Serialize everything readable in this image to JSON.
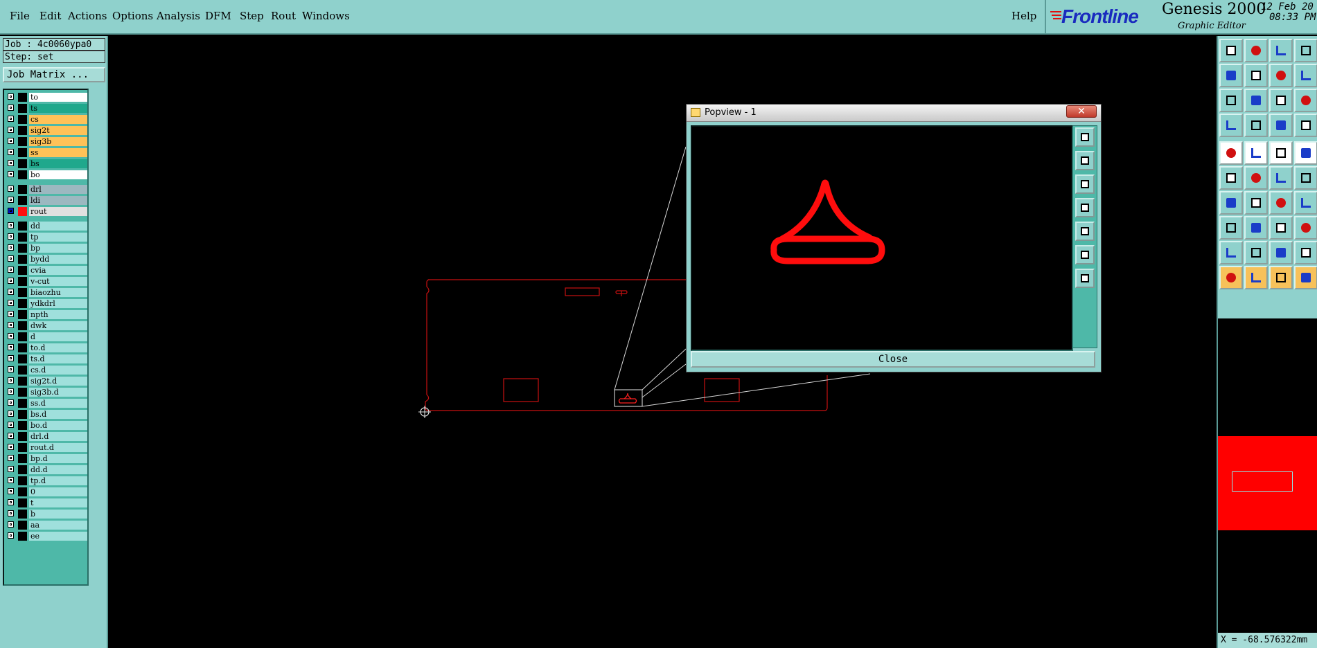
{
  "menu": {
    "items": [
      "File",
      "Edit",
      "Actions",
      "Options",
      "Analysis",
      "DFM",
      "Step",
      "Rout",
      "Windows"
    ],
    "help": "Help"
  },
  "brand": {
    "logo": "Frontline",
    "product": "Genesis 2000",
    "subtitle": "Graphic Editor",
    "date": "12 Feb 20",
    "time": "08:33 PM"
  },
  "job": {
    "job_label": "Job : 4c0060ypa0",
    "step_label": "Step: set",
    "matrix_button": "Job Matrix ..."
  },
  "layers": {
    "board": [
      {
        "name": "to",
        "color": "#ffffff"
      },
      {
        "name": "ts",
        "color": "#1fa88c"
      },
      {
        "name": "cs",
        "color": "#ffc258"
      },
      {
        "name": "sig2t",
        "color": "#ffc258"
      },
      {
        "name": "sig3b",
        "color": "#ffc258"
      },
      {
        "name": "ss",
        "color": "#ffc258"
      },
      {
        "name": "bs",
        "color": "#1fa88c"
      },
      {
        "name": "bo",
        "color": "#ffffff"
      }
    ],
    "drill": [
      {
        "name": "drl",
        "color": "#9cb8c0"
      },
      {
        "name": "ldi",
        "color": "#9cb8c0"
      },
      {
        "name": "rout",
        "color": "#e0e0e0",
        "active": true
      }
    ],
    "misc": [
      "dd",
      "tp",
      "bp",
      "bydd",
      "cvia",
      "v-cut",
      "biaozhu",
      "ydkdrl",
      "npth",
      "dwk",
      "d",
      "to.d",
      "ts.d",
      "cs.d",
      "sig2t.d",
      "sig3b.d",
      "ss.d",
      "bs.d",
      "bo.d",
      "drl.d",
      "rout.d",
      "bp.d",
      "dd.d",
      "tp.d",
      "0",
      "t",
      "b",
      "aa",
      "ee"
    ],
    "misc_color": "#9fe0dc"
  },
  "popview": {
    "title": "Popview - 1",
    "close_x": "✕",
    "close_button": "Close"
  },
  "status": {
    "coord": "X = -68.576322mm"
  },
  "colors": {
    "panel": "#8fd1cc",
    "shape": "#ff1010"
  }
}
